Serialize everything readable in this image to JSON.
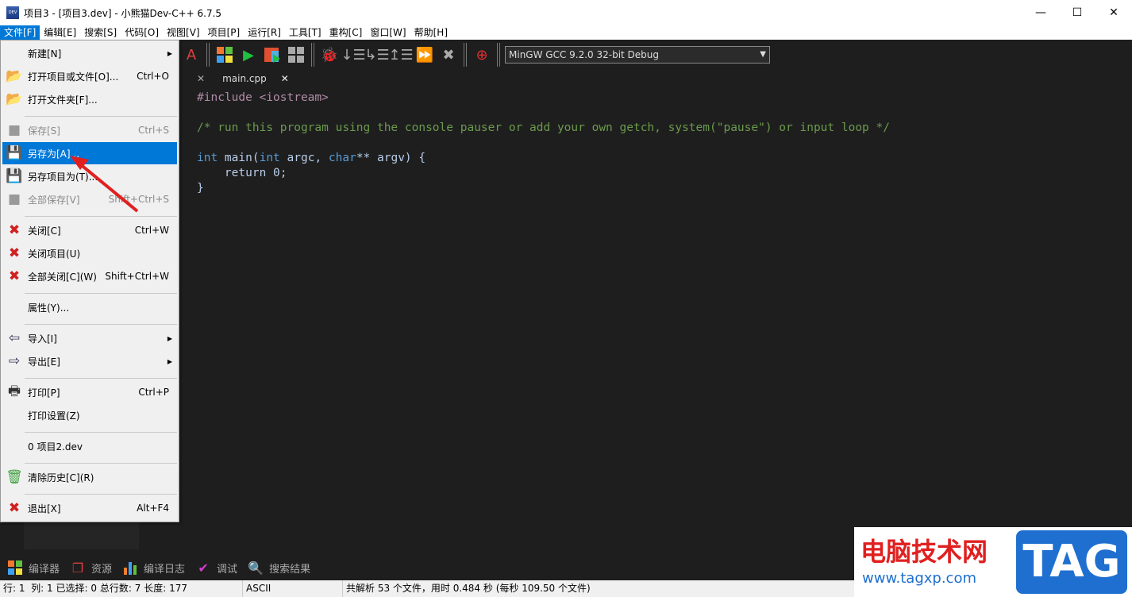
{
  "window": {
    "title": "项目3 - [项目3.dev] - 小熊猫Dev-C++ 6.7.5",
    "icon_text": "DEV",
    "minimize": "—",
    "maximize": "☐",
    "close": "✕"
  },
  "menubar": [
    "文件[F]",
    "编辑[E]",
    "搜索[S]",
    "代码[O]",
    "视图[V]",
    "项目[P]",
    "运行[R]",
    "工具[T]",
    "重构[C]",
    "窗口[W]",
    "帮助[H]"
  ],
  "toolbar": {
    "compiler": "MinGW GCC 9.2.0 32-bit Debug"
  },
  "tabs": [
    {
      "label": "main.cpp",
      "close": "✕"
    }
  ],
  "code": {
    "l1": "#include <iostream>",
    "l3": "/* run this program using the console pauser or add your own getch, system(\"pause\") or input loop */",
    "l5a": "int",
    " l5b": "",
    "l5_rest1": " main(",
    "l5_int": "int",
    "l5_rest2": " argc, ",
    "l5_char": "char",
    "l5_rest3": "** argv) {",
    "l6_kw": "    return",
    "l6_rest": " 0;",
    "l7": "}"
  },
  "file_menu": [
    {
      "label": "新建[N]",
      "shortcut": "",
      "submenu": true,
      "icon": "none"
    },
    {
      "label": "打开项目或文件[O]...",
      "shortcut": "Ctrl+O",
      "icon": "folder-open-icon"
    },
    {
      "label": "打开文件夹[F]...",
      "shortcut": "",
      "icon": "folder-open-icon"
    },
    {
      "label": "保存[S]",
      "shortcut": "Ctrl+S",
      "disabled": true,
      "icon": "save-icon"
    },
    {
      "label": "另存为[A]...",
      "shortcut": "",
      "selected": true,
      "icon": "floppy-icon"
    },
    {
      "label": "另存项目为(T)...",
      "shortcut": "",
      "icon": "floppy-icon"
    },
    {
      "label": "全部保存[V]",
      "shortcut": "Shift+Ctrl+S",
      "disabled": true,
      "icon": "save-all-icon"
    },
    {
      "label": "关闭[C]",
      "shortcut": "Ctrl+W",
      "icon": "close-file-icon"
    },
    {
      "label": "关闭项目(U)",
      "shortcut": "",
      "icon": "close-project-icon"
    },
    {
      "label": "全部关闭[C](W)",
      "shortcut": "Shift+Ctrl+W",
      "icon": "close-all-icon"
    },
    {
      "label": "属性(Y)...",
      "shortcut": "",
      "icon": "none"
    },
    {
      "label": "导入[I]",
      "shortcut": "",
      "submenu": true,
      "icon": "import-icon"
    },
    {
      "label": "导出[E]",
      "shortcut": "",
      "submenu": true,
      "icon": "export-icon"
    },
    {
      "label": "打印[P]",
      "shortcut": "Ctrl+P",
      "icon": "printer-icon"
    },
    {
      "label": "打印设置(Z)",
      "shortcut": "",
      "icon": "none"
    },
    {
      "label": "0 项目2.dev",
      "shortcut": "",
      "icon": "none"
    },
    {
      "label": "清除历史[C](R)",
      "shortcut": "",
      "icon": "trash-icon"
    },
    {
      "label": "退出[X]",
      "shortcut": "Alt+F4",
      "icon": "exit-icon"
    }
  ],
  "bottom_tabs": [
    "编译器",
    "资源",
    "编译日志",
    "调试",
    "搜索结果"
  ],
  "status": {
    "line_label": "行:",
    "line": "1",
    "col_label": "列:",
    "col": "1",
    "sel_label": "已选择:",
    "sel": "0",
    "total_label": "总行数:",
    "total": "7",
    "len_label": "长度:",
    "len": "177",
    "encoding": "ASCII",
    "parse": "共解析 53 个文件，用时 0.484 秒 (每秒 109.50 个文件)"
  },
  "watermark": {
    "cn": "电脑技术网",
    "url": "www.tagxp.com",
    "logo": "TAG"
  },
  "colors": {
    "menu_highlight": "#0078d7",
    "editor_bg": "#1e1e1e",
    "keyword": "#569cd6",
    "comment": "#6b9a4e",
    "arrow": "#e02020"
  }
}
